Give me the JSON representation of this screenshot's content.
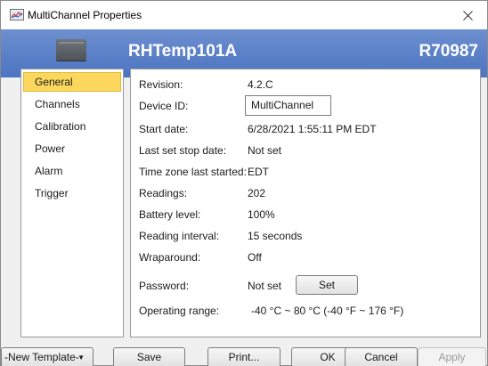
{
  "window": {
    "title": "MultiChannel Properties"
  },
  "banner": {
    "device_name": "RHTemp101A",
    "serial": "R70987",
    "color": "#4b74c1"
  },
  "sidebar": {
    "items": [
      {
        "label": "General",
        "active": true
      },
      {
        "label": "Channels"
      },
      {
        "label": "Calibration"
      },
      {
        "label": "Power"
      },
      {
        "label": "Alarm"
      },
      {
        "label": "Trigger"
      }
    ],
    "active_color": "#fbd85d"
  },
  "general": {
    "revision": {
      "label": "Revision:",
      "value": "4.2.C"
    },
    "device_id": {
      "label": "Device ID:",
      "value": "MultiChannel"
    },
    "start_date": {
      "label": "Start date:",
      "value": "6/28/2021 1:55:11 PM EDT"
    },
    "last_stop_date": {
      "label": "Last set stop date:",
      "value": "Not set"
    },
    "time_zone": {
      "label": "Time zone last started:",
      "value": "EDT"
    },
    "readings": {
      "label": "Readings:",
      "value": "202"
    },
    "battery": {
      "label": "Battery level:",
      "value": "100%"
    },
    "interval": {
      "label": "Reading interval:",
      "value": "15 seconds"
    },
    "wraparound": {
      "label": "Wraparound:",
      "value": "Off"
    },
    "password": {
      "label": "Password:",
      "value": "Not set",
      "button": "Set"
    },
    "operating_range": {
      "label": "Operating range:",
      "value": "-40 °C ~ 80 °C (-40 °F ~ 176 °F)"
    }
  },
  "footer": {
    "template": "-New Template-",
    "save": "Save",
    "print": "Print...",
    "ok": "OK",
    "cancel": "Cancel",
    "apply": "Apply"
  },
  "icons": {
    "app": "multichannel-app-icon",
    "close": "close-icon",
    "device": "device-icon",
    "dropdown": "chevron-down-icon"
  }
}
